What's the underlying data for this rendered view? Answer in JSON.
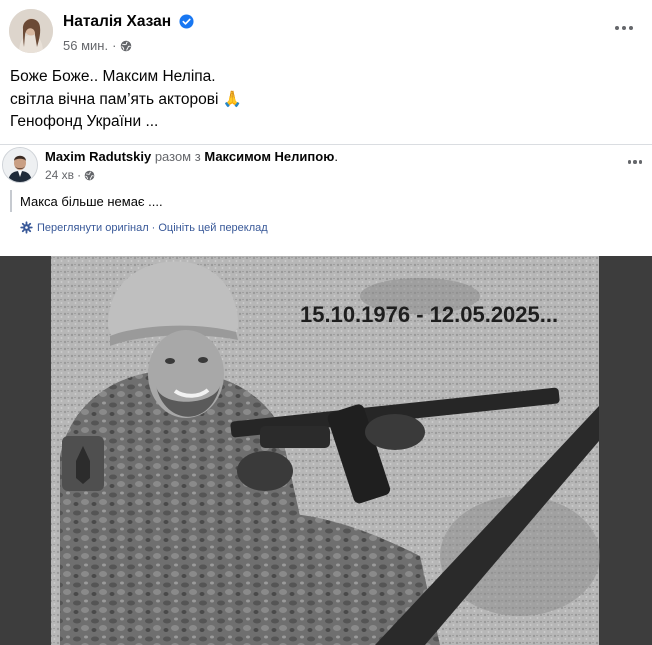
{
  "post": {
    "author_name": "Наталія Хазан",
    "time": "56 мин.",
    "separator": "·",
    "text_lines": [
      "Боже Боже.. Максим Неліпа.",
      "світла вічна пам’ять акторові 🙏",
      "Генофонд України ..."
    ]
  },
  "shared_post": {
    "author": "Maxim Radutskiy",
    "with_text": "разом з",
    "tagged": "Максимом Нелипою",
    "period": ".",
    "time": "24 хв",
    "separator": "·",
    "text": "Макса більше немає ....",
    "translation": {
      "view_original": "Переглянути оригінал",
      "separator": "·",
      "rate": "Оцініть цей переклад"
    }
  },
  "photo": {
    "dates": "15.10.1976 - 12.05.2025..."
  },
  "icons": {
    "verified": "verified-badge-icon",
    "audience": "globe-icon",
    "more": "more-options-icon",
    "translate": "gear-icon"
  },
  "colors": {
    "verified_blue": "#1877f2",
    "meta_gray": "#65676b",
    "link_blue": "#385898"
  }
}
